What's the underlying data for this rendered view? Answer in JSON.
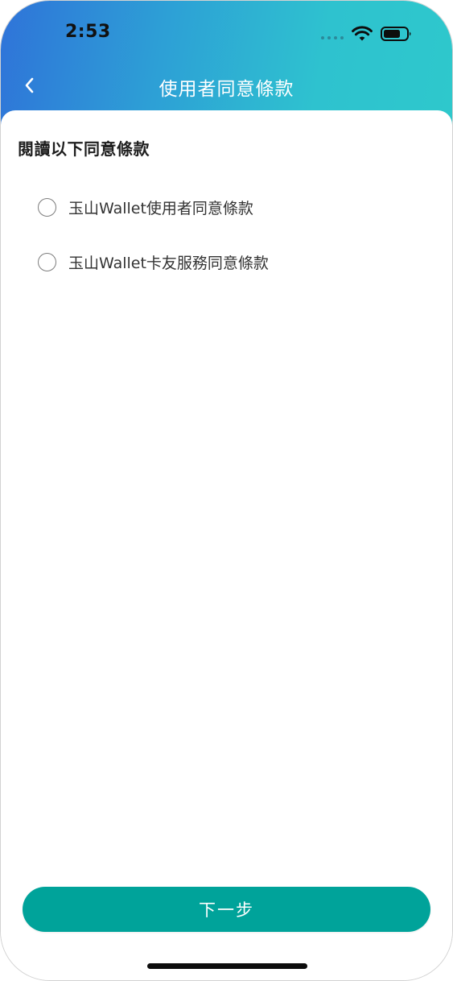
{
  "status_bar": {
    "time": "2:53",
    "wifi_icon": "wifi-icon",
    "battery_icon": "battery-icon"
  },
  "nav": {
    "back_icon": "chevron-left-icon",
    "title": "使用者同意條款"
  },
  "content": {
    "heading": "閱讀以下同意條款",
    "terms": [
      {
        "label": "玉山Wallet使用者同意條款",
        "checked": false
      },
      {
        "label": "玉山Wallet卡友服務同意條款",
        "checked": false
      }
    ]
  },
  "footer": {
    "next_label": "下一步"
  },
  "colors": {
    "header_gradient_start": "#2f73d9",
    "header_gradient_end": "#2ec8cc",
    "primary_button": "#00a39a",
    "radio_border": "#7d7d7d"
  }
}
